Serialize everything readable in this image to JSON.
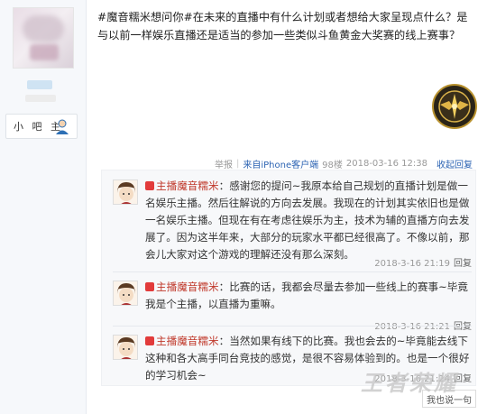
{
  "user": {
    "role_label": "小 吧 主"
  },
  "post": {
    "text": "#魔音糯米想问你#在未来的直播中有什么计划或者想给大家呈现点什么？是与以前一样娱乐直播还是适当的参加一些类似斗鱼黄金大奖赛的线上赛事？",
    "meta": {
      "report": "举报",
      "from": "来自iPhone客户端",
      "floor": "98楼",
      "time": "2018-03-16 12:38",
      "collapse": "收起回复"
    }
  },
  "replies": [
    {
      "author": "主播魔音糯米",
      "content": "感谢您的提问~我原本给自己规划的直播计划是做一名娱乐主播。然后往解说的方向去发展。我现在的计划其实依旧也是做一名娱乐主播。但现在有在考虑往娱乐为主，技术为辅的直播方向去发展了。因为这半年来，大部分的玩家水平都已经很高了。不像以前，那会儿大家对这个游戏的理解还没有那么深刻。",
      "time": "2018-3-16 21:19",
      "reply_label": "回复"
    },
    {
      "author": "主播魔音糯米",
      "content": "比赛的话，我都会尽量去参加一些线上的赛事~毕竟我是个主播，以直播为重嘛。",
      "time": "2018-3-16 21:21",
      "reply_label": "回复"
    },
    {
      "author": "主播魔音糯米",
      "content": "当然如果有线下的比赛。我也会去的~毕竟能去线下这种和各大高手同台竞技的感觉，是很不容易体验到的。也是一个很好的学习机会~",
      "time": "2018-3-16 21:24",
      "reply_label": "回复"
    }
  ],
  "input": {
    "say_label": "我也说一句"
  },
  "watermark": "王者荣耀"
}
